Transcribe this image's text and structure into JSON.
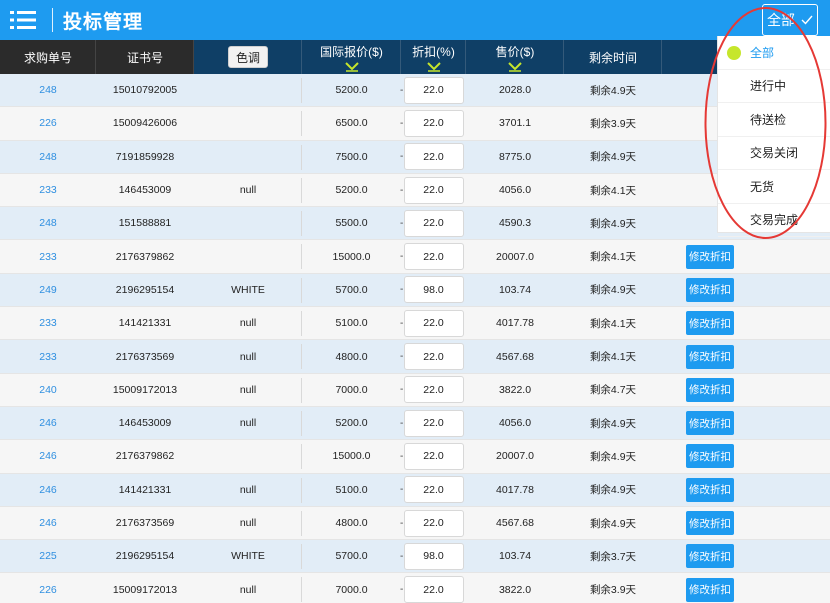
{
  "header": {
    "title": "投标管理",
    "filter_label": "全部"
  },
  "columns": [
    {
      "key": "order",
      "label": "求购单号",
      "sortable": false
    },
    {
      "key": "cert",
      "label": "证书号",
      "sortable": false
    },
    {
      "key": "tone",
      "label": "色调",
      "sortable": false
    },
    {
      "key": "intl_price",
      "label": "国际报价($)",
      "sortable": true
    },
    {
      "key": "discount",
      "label": "折扣(%)",
      "sortable": true
    },
    {
      "key": "price",
      "label": "售价($)",
      "sortable": true
    },
    {
      "key": "remaining",
      "label": "剩余时间",
      "sortable": false
    }
  ],
  "action_label": "修改折扣",
  "rows": [
    {
      "order": "248",
      "cert": "15010792005",
      "tone": "",
      "intl_price": "5200.0",
      "discount": "22.0",
      "price": "2028.0",
      "remaining": "剩余4.9天",
      "action": false
    },
    {
      "order": "226",
      "cert": "15009426006",
      "tone": "",
      "intl_price": "6500.0",
      "discount": "22.0",
      "price": "3701.1",
      "remaining": "剩余3.9天",
      "action": false
    },
    {
      "order": "248",
      "cert": "7191859928",
      "tone": "",
      "intl_price": "7500.0",
      "discount": "22.0",
      "price": "8775.0",
      "remaining": "剩余4.9天",
      "action": false
    },
    {
      "order": "233",
      "cert": "146453009",
      "tone": "null",
      "intl_price": "5200.0",
      "discount": "22.0",
      "price": "4056.0",
      "remaining": "剩余4.1天",
      "action": false
    },
    {
      "order": "248",
      "cert": "151588881",
      "tone": "",
      "intl_price": "5500.0",
      "discount": "22.0",
      "price": "4590.3",
      "remaining": "剩余4.9天",
      "action": false
    },
    {
      "order": "233",
      "cert": "2176379862",
      "tone": "",
      "intl_price": "15000.0",
      "discount": "22.0",
      "price": "20007.0",
      "remaining": "剩余4.1天",
      "action": true
    },
    {
      "order": "249",
      "cert": "2196295154",
      "tone": "WHITE",
      "intl_price": "5700.0",
      "discount": "98.0",
      "price": "103.74",
      "remaining": "剩余4.9天",
      "action": true
    },
    {
      "order": "233",
      "cert": "141421331",
      "tone": "null",
      "intl_price": "5100.0",
      "discount": "22.0",
      "price": "4017.78",
      "remaining": "剩余4.1天",
      "action": true
    },
    {
      "order": "233",
      "cert": "2176373569",
      "tone": "null",
      "intl_price": "4800.0",
      "discount": "22.0",
      "price": "4567.68",
      "remaining": "剩余4.1天",
      "action": true
    },
    {
      "order": "240",
      "cert": "15009172013",
      "tone": "null",
      "intl_price": "7000.0",
      "discount": "22.0",
      "price": "3822.0",
      "remaining": "剩余4.7天",
      "action": true
    },
    {
      "order": "246",
      "cert": "146453009",
      "tone": "null",
      "intl_price": "5200.0",
      "discount": "22.0",
      "price": "4056.0",
      "remaining": "剩余4.9天",
      "action": true
    },
    {
      "order": "246",
      "cert": "2176379862",
      "tone": "",
      "intl_price": "15000.0",
      "discount": "22.0",
      "price": "20007.0",
      "remaining": "剩余4.9天",
      "action": true
    },
    {
      "order": "246",
      "cert": "141421331",
      "tone": "null",
      "intl_price": "5100.0",
      "discount": "22.0",
      "price": "4017.78",
      "remaining": "剩余4.9天",
      "action": true
    },
    {
      "order": "246",
      "cert": "2176373569",
      "tone": "null",
      "intl_price": "4800.0",
      "discount": "22.0",
      "price": "4567.68",
      "remaining": "剩余4.9天",
      "action": true
    },
    {
      "order": "225",
      "cert": "2196295154",
      "tone": "WHITE",
      "intl_price": "5700.0",
      "discount": "98.0",
      "price": "103.74",
      "remaining": "剩余3.7天",
      "action": true
    },
    {
      "order": "226",
      "cert": "15009172013",
      "tone": "null",
      "intl_price": "7000.0",
      "discount": "22.0",
      "price": "3822.0",
      "remaining": "剩余3.9天",
      "action": true
    }
  ],
  "dropdown": {
    "items": [
      {
        "label": "全部",
        "selected": true
      },
      {
        "label": "进行中",
        "selected": false
      },
      {
        "label": "待送检",
        "selected": false
      },
      {
        "label": "交易关闭",
        "selected": false
      },
      {
        "label": "无货",
        "selected": false
      },
      {
        "label": "交易完成",
        "selected": false
      }
    ]
  },
  "colors": {
    "header_bg": "#1e9bf0",
    "column_header_dark": "#2b2b2b",
    "column_header_blue": "#0f3f66",
    "row_alt": "#e2edf7",
    "row_plain": "#f6f6f6",
    "link": "#2f8fe0",
    "accent": "#1e9bf0",
    "selected_dot": "#c6e62b",
    "annotation_ring": "#e53935",
    "sort_caret": "#c6e62b"
  }
}
